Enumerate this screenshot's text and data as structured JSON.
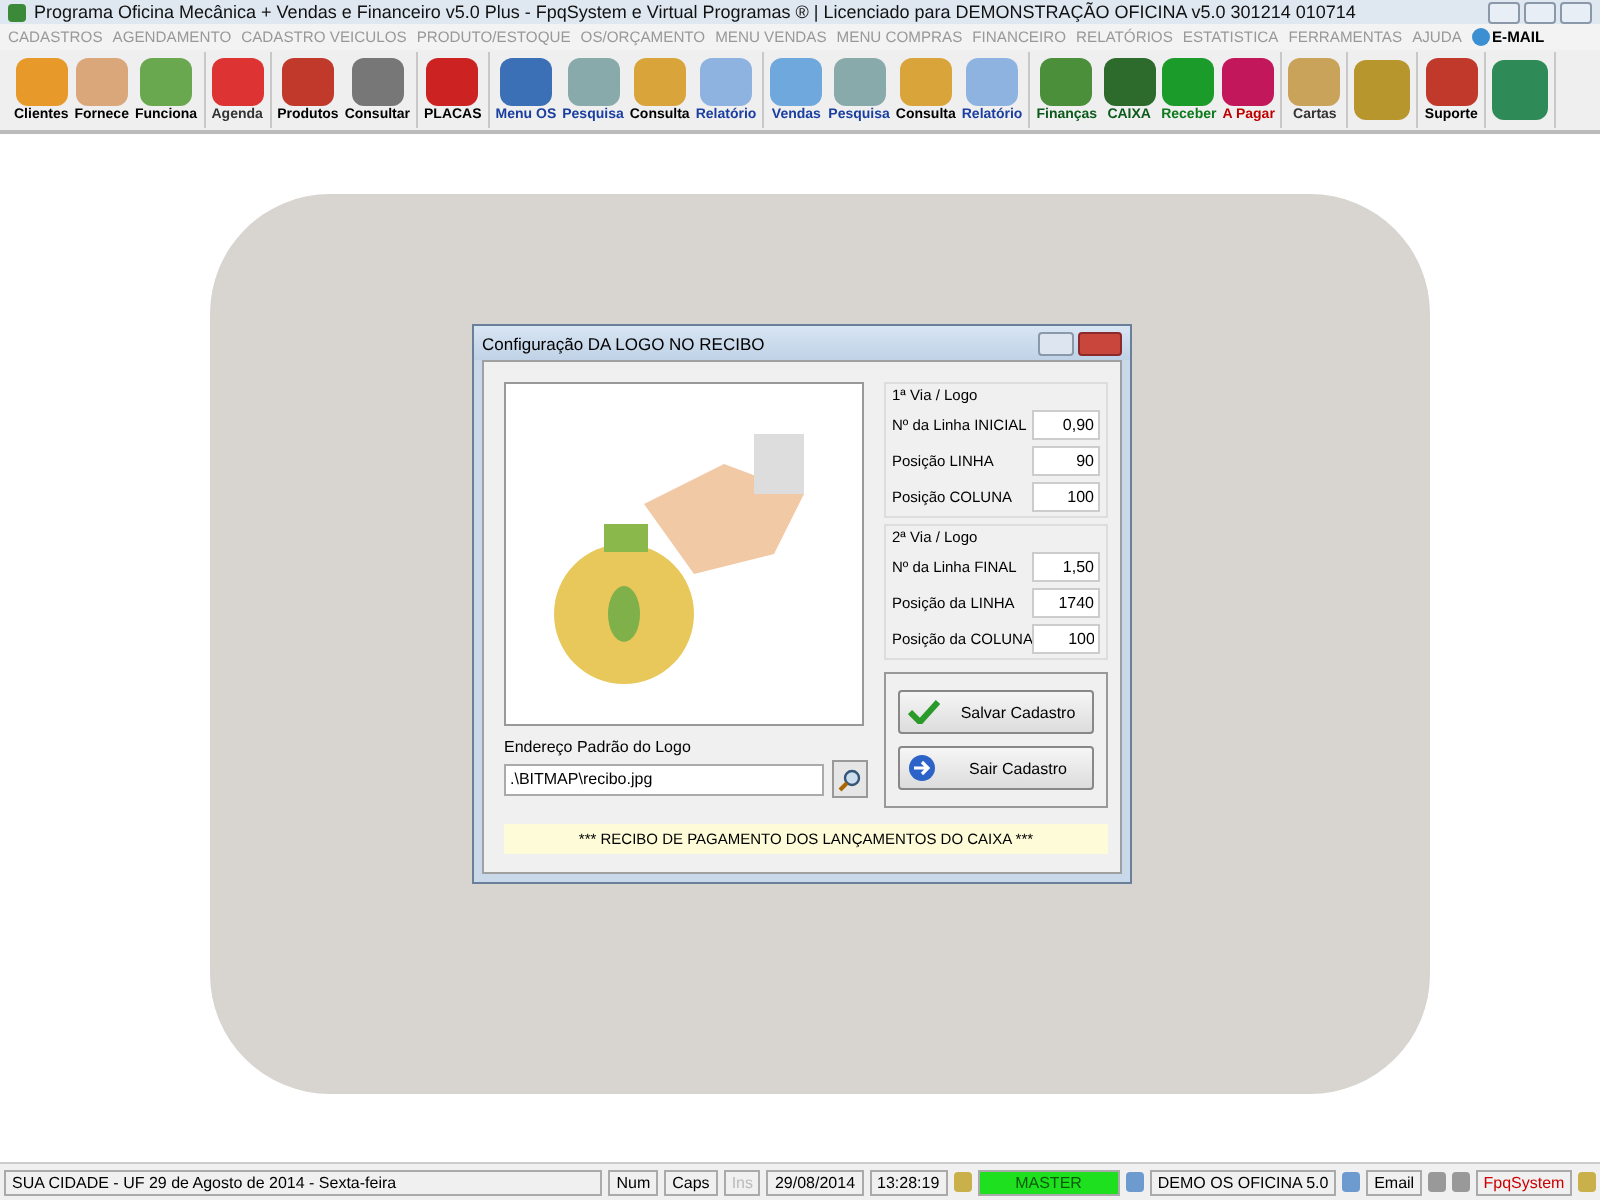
{
  "window": {
    "title": "Programa Oficina Mecânica + Vendas e Financeiro v5.0 Plus - FpqSystem e Virtual Programas ® | Licenciado para  DEMONSTRAÇÃO OFICINA v5.0 301214 010714"
  },
  "menu": [
    "CADASTROS",
    "AGENDAMENTO",
    "CADASTRO VEICULOS",
    "PRODUTO/ESTOQUE",
    "OS/ORÇAMENTO",
    "MENU VENDAS",
    "MENU COMPRAS",
    "FINANCEIRO",
    "RELATÓRIOS",
    "ESTATISTICA",
    "FERRAMENTAS",
    "AJUDA"
  ],
  "email_menu": "E-MAIL",
  "toolbar": [
    [
      {
        "label": "Clientes",
        "color": "#000000"
      },
      {
        "label": "Fornece",
        "color": "#000000"
      },
      {
        "label": "Funciona",
        "color": "#000000"
      }
    ],
    [
      {
        "label": "Agenda",
        "color": "#333333"
      }
    ],
    [
      {
        "label": "Produtos",
        "color": "#000000"
      },
      {
        "label": "Consultar",
        "color": "#000000"
      }
    ],
    [
      {
        "label": "PLACAS",
        "color": "#000000"
      }
    ],
    [
      {
        "label": "Menu OS",
        "color": "#1a3fa0"
      },
      {
        "label": "Pesquisa",
        "color": "#1a3fa0"
      },
      {
        "label": "Consulta",
        "color": "#000000"
      },
      {
        "label": "Relatório",
        "color": "#1a3fa0"
      }
    ],
    [
      {
        "label": "Vendas",
        "color": "#1a3fa0"
      },
      {
        "label": "Pesquisa",
        "color": "#1a3fa0"
      },
      {
        "label": "Consulta",
        "color": "#000000"
      },
      {
        "label": "Relatório",
        "color": "#1a3fa0"
      }
    ],
    [
      {
        "label": "Finanças",
        "color": "#0b5a1a"
      },
      {
        "label": "CAIXA",
        "color": "#0b5a1a"
      },
      {
        "label": "Receber",
        "color": "#0b7a1a"
      },
      {
        "label": "A Pagar",
        "color": "#c00000"
      }
    ],
    [
      {
        "label": "Cartas",
        "color": "#333333"
      }
    ],
    [
      {
        "kind": "icon"
      }
    ],
    [
      {
        "label": "Suporte",
        "color": "#000000"
      }
    ],
    [
      {
        "kind": "icon"
      }
    ]
  ],
  "dialog": {
    "title": "Configuração DA LOGO NO RECIBO",
    "groups": [
      {
        "heading": "1ª Via / Logo",
        "fields": [
          {
            "label": "Nº da Linha INICIAL",
            "value": "0,90"
          },
          {
            "label": "Posição LINHA",
            "value": "90"
          },
          {
            "label": "Posição COLUNA",
            "value": "100"
          }
        ]
      },
      {
        "heading": "2ª Via / Logo",
        "fields": [
          {
            "label": "Nº da Linha FINAL",
            "value": "1,50"
          },
          {
            "label": "Posição da LINHA",
            "value": "1740"
          },
          {
            "label": "Posição da COLUNA",
            "value": "100"
          }
        ]
      }
    ],
    "path_label": "Endereço Padrão do Logo",
    "path_value": ".\\BITMAP\\recibo.jpg",
    "buttons": [
      {
        "label": "Salvar Cadastro",
        "kind": "save"
      },
      {
        "label": "Sair Cadastro",
        "kind": "exit"
      }
    ],
    "footer": "*** RECIBO DE PAGAMENTO DOS LANÇAMENTOS DO CAIXA ***"
  },
  "status_bar": {
    "location": "SUA CIDADE - UF 29 de Agosto de 2014 - Sexta-feira",
    "keys": [
      {
        "label": "Num",
        "disabled": false
      },
      {
        "label": "Caps",
        "disabled": false
      },
      {
        "label": "Ins",
        "disabled": true
      }
    ],
    "date": "29/08/2014",
    "time": "13:28:19",
    "user": "MASTER",
    "demo": "DEMO OS OFICINA 5.0",
    "email": "Email",
    "brand": "FpqSystem"
  }
}
